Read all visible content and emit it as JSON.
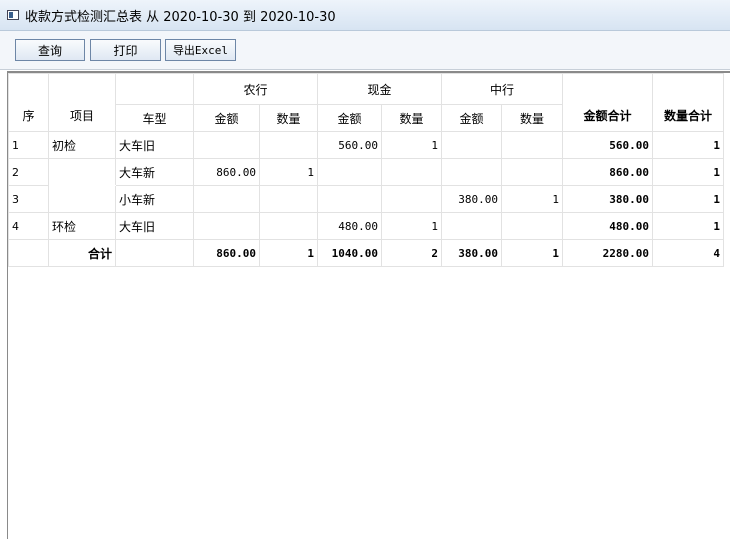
{
  "window": {
    "title": "收款方式检测汇总表 从 2020-10-30 到 2020-10-30"
  },
  "toolbar": {
    "query_label": "查询",
    "print_label": "打印",
    "export_label": "导出Excel"
  },
  "table": {
    "groups": [
      "农行",
      "现金",
      "中行"
    ],
    "total_amount_header": "金额合计",
    "total_qty_header": "数量合计",
    "cols": {
      "seq": "序",
      "item": "项目",
      "type": "车型",
      "amount": "金额",
      "qty": "数量"
    },
    "rows": [
      {
        "seq": "1",
        "item": "初检",
        "type": "大车旧",
        "abc_amount": "",
        "abc_qty": "",
        "cash_amount": "560.00",
        "cash_qty": "1",
        "boc_amount": "",
        "boc_qty": "",
        "total_amount": "560.00",
        "total_qty": "1"
      },
      {
        "seq": "2",
        "item": "",
        "type": "大车新",
        "abc_amount": "860.00",
        "abc_qty": "1",
        "cash_amount": "",
        "cash_qty": "",
        "boc_amount": "",
        "boc_qty": "",
        "total_amount": "860.00",
        "total_qty": "1"
      },
      {
        "seq": "3",
        "item": "",
        "type": "小车新",
        "abc_amount": "",
        "abc_qty": "",
        "cash_amount": "",
        "cash_qty": "",
        "boc_amount": "380.00",
        "boc_qty": "1",
        "total_amount": "380.00",
        "total_qty": "1"
      },
      {
        "seq": "4",
        "item": "环检",
        "type": "大车旧",
        "abc_amount": "",
        "abc_qty": "",
        "cash_amount": "480.00",
        "cash_qty": "1",
        "boc_amount": "",
        "boc_qty": "",
        "total_amount": "480.00",
        "total_qty": "1"
      }
    ],
    "summary": {
      "label": "合计",
      "abc_amount": "860.00",
      "abc_qty": "1",
      "cash_amount": "1040.00",
      "cash_qty": "2",
      "boc_amount": "380.00",
      "boc_qty": "1",
      "total_amount": "2280.00",
      "total_qty": "4"
    }
  }
}
